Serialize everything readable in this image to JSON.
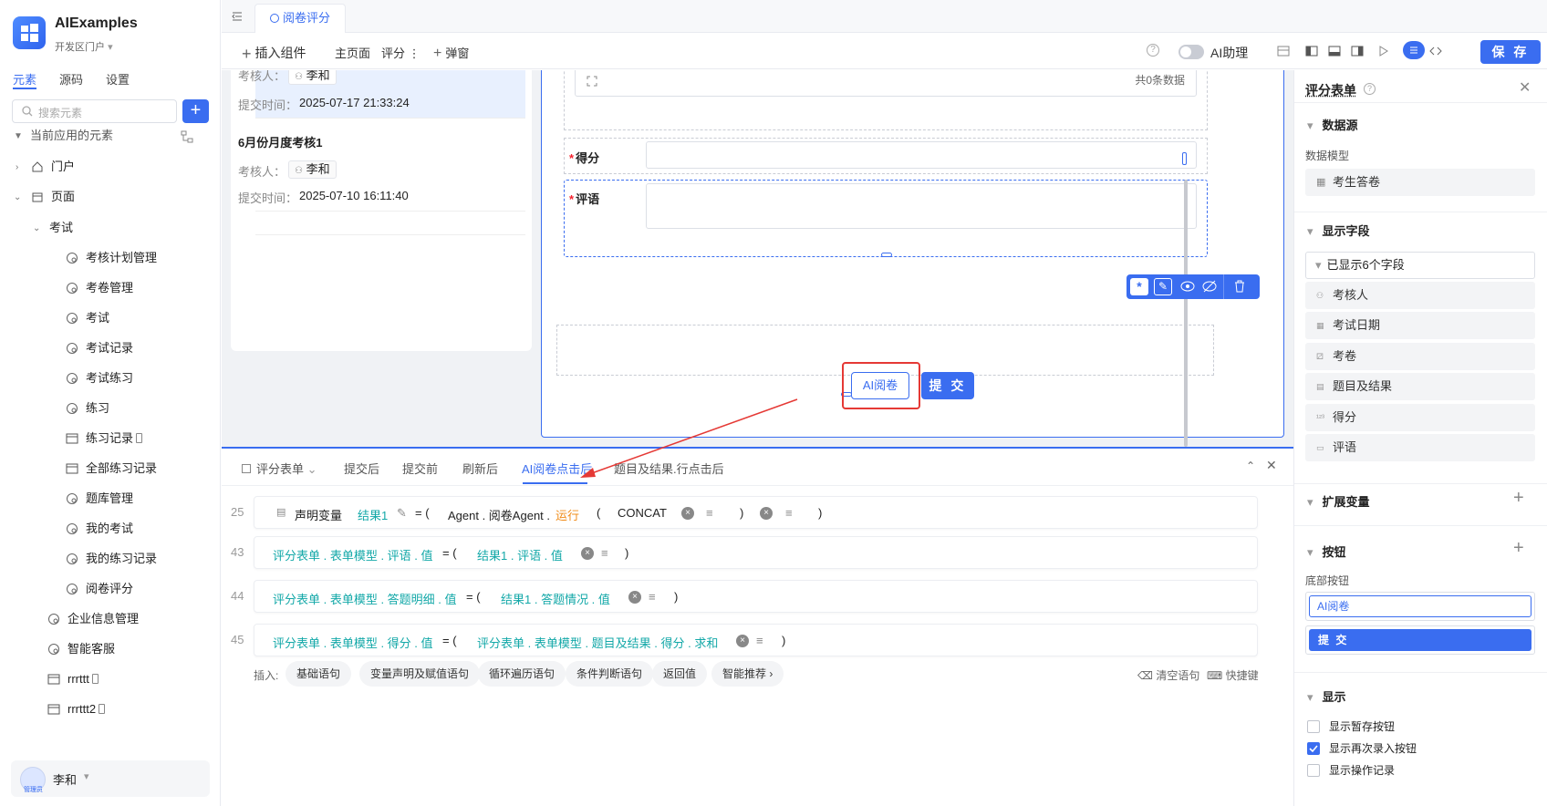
{
  "app": {
    "name": "AIExamples",
    "portal": "开发区门户"
  },
  "left_tabs": [
    "元素",
    "源码",
    "设置"
  ],
  "search": {
    "placeholder": "搜索元素"
  },
  "tree": {
    "section": "当前应用的元素",
    "items": [
      {
        "label": "门户"
      },
      {
        "label": "页面"
      },
      {
        "label": "考试"
      },
      {
        "label": "考核计划管理"
      },
      {
        "label": "考卷管理"
      },
      {
        "label": "考试"
      },
      {
        "label": "考试记录"
      },
      {
        "label": "考试练习"
      },
      {
        "label": "练习"
      },
      {
        "label": "练习记录"
      },
      {
        "label": "全部练习记录"
      },
      {
        "label": "题库管理"
      },
      {
        "label": "我的考试"
      },
      {
        "label": "我的练习记录"
      },
      {
        "label": "阅卷评分"
      },
      {
        "label": "企业信息管理"
      },
      {
        "label": "智能客服"
      },
      {
        "label": "rrrttt"
      },
      {
        "label": "rrrttt2"
      }
    ]
  },
  "user": {
    "name": "李和",
    "badge": "管理员"
  },
  "top_tab": "阅卷评分",
  "toolbar": {
    "insert": "插入组件",
    "main_page": "主页面",
    "score": "评分",
    "popup": "弹窗",
    "ai_assistant": "AI助理",
    "save": "保 存"
  },
  "list": {
    "item1": {
      "reviewer_label": "考核人：",
      "reviewer": "李和",
      "time_label": "提交时间：",
      "time": "2025-07-17 21:33:24"
    },
    "item2": {
      "title": "6月份月度考核1",
      "reviewer_label": "考核人：",
      "reviewer": "李和",
      "time_label": "提交时间：",
      "time": "2025-07-10 16:11:40"
    }
  },
  "form": {
    "total": "共0条数据",
    "score_label": "得分",
    "comment_label": "评语",
    "ai_button": "AI阅卷",
    "submit_button": "提 交"
  },
  "bottom": {
    "tabs": [
      "评分表单",
      "提交后",
      "提交前",
      "刷新后",
      "AI阅卷点击后",
      "题目及结果.行点击后"
    ],
    "rows": [
      {
        "no": "25",
        "tokens": [
          "声明变量",
          "结果1",
          "= (",
          "Agent . 阅卷Agent .",
          "运行",
          "(",
          "CONCAT",
          ")",
          ")"
        ]
      },
      {
        "no": "43",
        "tokens": [
          "评分表单 . 表单模型 . 评语 . 值",
          "= (",
          "结果1 . 评语 . 值",
          ")"
        ]
      },
      {
        "no": "44",
        "tokens": [
          "评分表单 . 表单模型 . 答题明细 . 值",
          "= (",
          "结果1 . 答题情况 . 值",
          ")"
        ]
      },
      {
        "no": "45",
        "tokens": [
          "评分表单 . 表单模型 . 得分 . 值",
          "= (",
          "评分表单 . 表单模型 . 题目及结果 . 得分 . 求和",
          ")"
        ]
      }
    ],
    "insert_label": "插入:",
    "chips": [
      "基础语句",
      "变量声明及赋值语句",
      "循环遍历语句",
      "条件判断语句",
      "返回值",
      "智能推荐 ›"
    ],
    "clear": "清空语句",
    "shortcut": "快捷键"
  },
  "right": {
    "title": "评分表单",
    "datasource": "数据源",
    "model_label": "数据模型",
    "model": "考生答卷",
    "fields_title": "显示字段",
    "fields_shown": "已显示6个字段",
    "fields": [
      "考核人",
      "考试日期",
      "考卷",
      "题目及结果",
      "得分",
      "评语"
    ],
    "ext_vars": "扩展变量",
    "buttons": "按钮",
    "bottom_buttons": "底部按钮",
    "btn1": "AI阅卷",
    "btn2": "提 交",
    "display": "显示",
    "chk1": "显示暂存按钮",
    "chk2": "显示再次录入按钮",
    "chk3": "显示操作记录"
  }
}
